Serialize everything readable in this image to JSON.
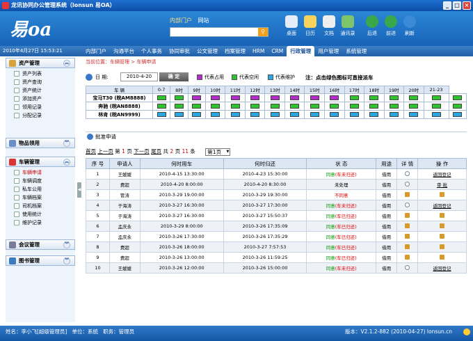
{
  "window": {
    "title": "龙讯协同办公管理系统（lonsun 易OA）",
    "min": "_",
    "max": "□",
    "close": "×"
  },
  "header": {
    "logo": "易oa",
    "portal_tabs": [
      "内部门户",
      "网站"
    ],
    "search_icon": "search-icon",
    "tools": [
      {
        "label": "桌面",
        "icon": "desktop-icon",
        "color": "#e4edf7"
      },
      {
        "label": "日历",
        "icon": "calendar-icon",
        "color": "#f7d35b"
      },
      {
        "label": "文档",
        "icon": "document-icon",
        "color": "#eeeeee"
      },
      {
        "label": "通讯录",
        "icon": "contacts-icon",
        "color": "#7ec46a"
      },
      {
        "label": "后退",
        "icon": "back-icon",
        "color": "#3aa84a"
      },
      {
        "label": "前进",
        "icon": "forward-icon",
        "color": "#3aa84a"
      },
      {
        "label": "刷新",
        "icon": "refresh-icon",
        "color": "#3a8ad8"
      }
    ]
  },
  "menubar": {
    "date": "2010年4月27日 15:53:21",
    "items": [
      "内部门户",
      "沟通平台",
      "个人事务",
      "协同审批",
      "公文管理",
      "档案管理",
      "HRM",
      "CRM",
      "行政管理",
      "用户管理",
      "系统管理"
    ],
    "active": "行政管理"
  },
  "sidebar": {
    "asset": {
      "title": "资产管理",
      "items": [
        "资产列表",
        "资产查询",
        "资产统计",
        "添加资产",
        "领用记录",
        "分配记录"
      ]
    },
    "goods": {
      "title": "物品领用"
    },
    "vehicle": {
      "title": "车辆管理",
      "items": [
        "车辆申请",
        "车辆调度",
        "私车公用",
        "车辆档案",
        "司机档案",
        "使用统计",
        "维护记录"
      ],
      "active": "车辆申请"
    },
    "meeting": {
      "title": "会议管理"
    },
    "books": {
      "title": "图书管理"
    }
  },
  "breadcrumb": "当前位置：车辆管理 > 车辆申请",
  "datebar": {
    "label": "日 期:",
    "date": "2010-4-20",
    "confirm": "确 定",
    "legend": [
      {
        "label": "代表占用",
        "color": "#b22dc9"
      },
      {
        "label": "代表空闲",
        "color": "#2fc32f"
      },
      {
        "label": "代表维护",
        "color": "#2aa6e0"
      }
    ],
    "note": "注：点击绿色图标可直接派车"
  },
  "vehicle_table": {
    "headers": [
      "车 辆",
      "0-7",
      "8时",
      "9时",
      "10时",
      "11时",
      "12时",
      "13时",
      "14时",
      "15时",
      "16时",
      "17时",
      "18时",
      "19时",
      "20时",
      "21-23"
    ],
    "rows": [
      {
        "car": "宝马T30 (皖AM8888)",
        "slots": [
          "g",
          "g",
          "p",
          "p",
          "p",
          "p",
          "p",
          "p",
          "p",
          "p",
          "g",
          "g",
          "g",
          "g",
          "g",
          "g"
        ]
      },
      {
        "car": "奔驰 (皖AN8888)",
        "slots": [
          "g",
          "g",
          "g",
          "g",
          "g",
          "g",
          "g",
          "g",
          "g",
          "g",
          "g",
          "g",
          "g",
          "g",
          "g",
          "g"
        ]
      },
      {
        "car": "林肯 (皖AN9999)",
        "slots": [
          "b",
          "b",
          "b",
          "b",
          "b",
          "b",
          "b",
          "b",
          "b",
          "b",
          "b",
          "b",
          "b",
          "b",
          "b",
          "b"
        ]
      }
    ]
  },
  "approval": {
    "title": "批准申请",
    "pager": {
      "first": "首页",
      "prev": "上一页",
      "p_pre": "第",
      "cur": "1",
      "p_suf": "页",
      "next": "下一页",
      "last": "尾页",
      "t_pre": "共",
      "total_pages": "2",
      "t_mid": "页",
      "records": "11",
      "t_suf": "条",
      "jump": "第1页"
    },
    "headers": [
      "序 号",
      "申请人",
      "何时用车",
      "何时归还",
      "状 态",
      "用途",
      "详 情",
      "操 作"
    ],
    "rows": [
      {
        "no": "1",
        "who": "王媛媛",
        "start": "2010-4-15 13:30:00",
        "end": "2010-4-23 15:30:00",
        "status": "同意",
        "sub": "(车未归还)",
        "sc": "green",
        "use": "借用",
        "detail": "mag",
        "op": "返回登记"
      },
      {
        "no": "2",
        "who": "费超",
        "start": "2010-4-20 8:00:00",
        "end": "2010-4-20 8:30:00",
        "status": "未处理",
        "sub": "",
        "sc": "none",
        "use": "借用",
        "detail": "mag",
        "op": "审 批"
      },
      {
        "no": "3",
        "who": "管涛",
        "start": "2010-3-29 19:00:00",
        "end": "2010-3-29 19:30:00",
        "status": "不同意",
        "sub": "",
        "sc": "red",
        "use": "借用",
        "detail": "lock",
        "op": ""
      },
      {
        "no": "4",
        "who": "于海涛",
        "start": "2010-3-27 16:30:00",
        "end": "2010-3-27 17:30:00",
        "status": "同意",
        "sub": "(车未归还)",
        "sc": "green",
        "use": "借用",
        "detail": "mag",
        "op": "返回登记"
      },
      {
        "no": "5",
        "who": "于海涛",
        "start": "2010-3-27 16:30:00",
        "end": "2010-3-27 15:50:37",
        "status": "同意",
        "sub": "(车已归还)",
        "sc": "green",
        "use": "借用",
        "detail": "lock",
        "op": ""
      },
      {
        "no": "6",
        "who": "孟庆永",
        "start": "2010-3-29 8:00:00",
        "end": "2010-3-26 17:35:09",
        "status": "同意",
        "sub": "(车已归还)",
        "sc": "green",
        "use": "借用",
        "detail": "lock",
        "op": ""
      },
      {
        "no": "7",
        "who": "孟庆永",
        "start": "2010-3-26 17:30:00",
        "end": "2010-3-26 17:35:29",
        "status": "同意",
        "sub": "(车已归还)",
        "sc": "green",
        "use": "借用",
        "detail": "lock",
        "op": ""
      },
      {
        "no": "8",
        "who": "费超",
        "start": "2010-3-26 18:00:00",
        "end": "2010-3-27 7:57:53",
        "status": "同意",
        "sub": "(车已归还)",
        "sc": "green",
        "use": "借用",
        "detail": "lock",
        "op": ""
      },
      {
        "no": "9",
        "who": "费超",
        "start": "2010-3-26 13:00:00",
        "end": "2010-3-26 11:59:25",
        "status": "同意",
        "sub": "(车已归还)",
        "sc": "green",
        "use": "借用",
        "detail": "lock",
        "op": ""
      },
      {
        "no": "10",
        "who": "王媛媛",
        "start": "2010-3-26 12:00:00",
        "end": "2010-3-26 15:00:00",
        "status": "同意",
        "sub": "(车未归还)",
        "sc": "green",
        "use": "借用",
        "detail": "mag",
        "op": "返回登记"
      }
    ]
  },
  "statusbar": {
    "user": "姓名：李小飞[超级管理员]",
    "unit": "单位：系统",
    "job": "职务：管理员",
    "version": "版本：V2.1.2-882 (2010-04-27)   lonsun.cn"
  }
}
